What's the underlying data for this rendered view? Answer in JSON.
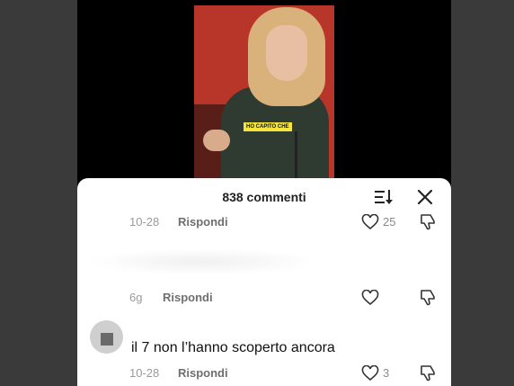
{
  "video": {
    "caption": "HO CAPITO CHE"
  },
  "sheet": {
    "title": "838 commenti"
  },
  "comments": [
    {
      "date": "10-28",
      "reply": "Rispondi",
      "likes": "25"
    },
    {
      "date": "6g",
      "reply": "Rispondi",
      "likes": ""
    },
    {
      "text": "il 7 non l’hanno scoperto ancora",
      "date": "10-28",
      "reply": "Rispondi",
      "likes": "3"
    }
  ],
  "icons": [
    "sort-icon",
    "close-icon",
    "heart-icon",
    "dislike-icon",
    "avatar"
  ]
}
